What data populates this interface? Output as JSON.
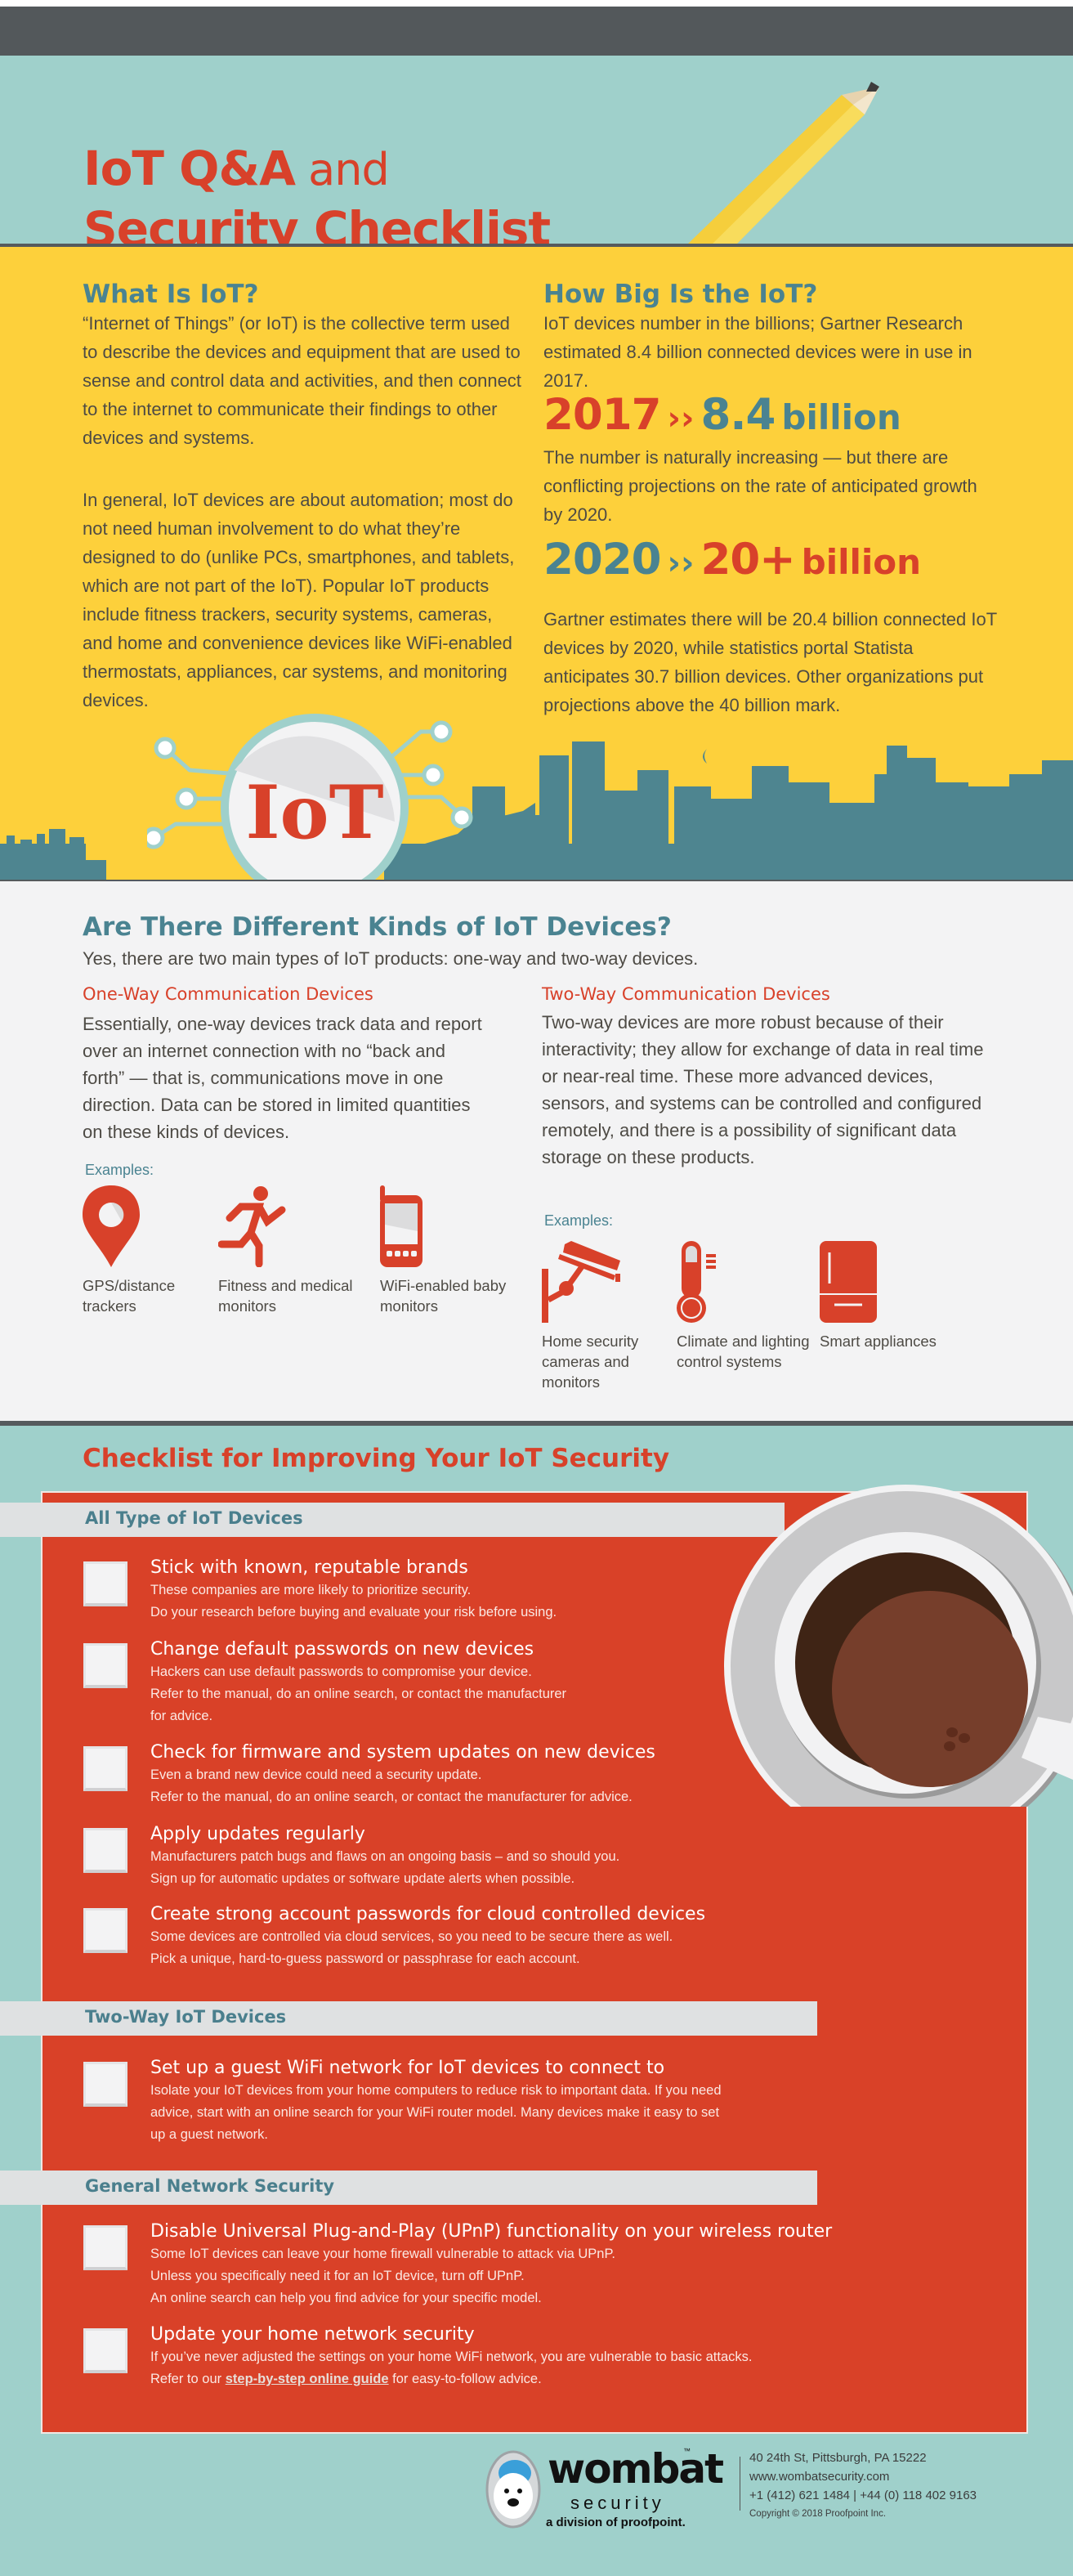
{
  "header": {
    "title_line1_bold": "IoT Q&A",
    "title_line1_light": " and",
    "title_line2": "Security Checklist"
  },
  "what_is_iot": {
    "title": "What Is IoT?",
    "paragraph1": "“Internet of Things” (or IoT) is the collective term used to describe the devices and equipment that are used to sense and control data and activities, and then connect to the internet to communicate their findings to other devices and systems.",
    "paragraph2": "In general, IoT devices are about automation; most do not need human involvement to do what they’re designed to do (unlike PCs, smartphones, and tablets, which are not part of the IoT). Popular IoT products include fitness trackers, security systems, cameras, and home and convenience devices like WiFi-enabled thermostats, appliances, car systems, and monitoring devices.",
    "badge_text": "IoT"
  },
  "how_big": {
    "title": "How Big Is the IoT?",
    "paragraph1": "IoT devices number in the billions; Gartner Research estimated 8.4 billion connected devices were in use in 2017.",
    "stat1": {
      "year": "2017",
      "arrow": "››",
      "value": "8.4",
      "unit": "billion"
    },
    "paragraph2": "The number is naturally increasing — but there are conflicting projections on the rate of anticipated growth by 2020.",
    "stat2": {
      "year": "2020",
      "arrow": "››",
      "value": "20+",
      "unit": "billion"
    },
    "paragraph3": "Gartner estimates there will be 20.4 billion connected IoT devices by 2020, while statistics portal Statista anticipates 30.7 billion devices. Other organizations put projections above the 40 billion mark."
  },
  "kinds": {
    "title": "Are There Different Kinds of IoT Devices?",
    "intro": "Yes, there are two main types of IoT products: one-way and two-way devices.",
    "one_way": {
      "title": "One-Way Communication Devices",
      "text": "Essentially, one-way devices track data and report over an internet connection with no “back and forth” — that is, communications move in one direction. Data can be stored in limited quantities on these kinds of devices.",
      "examples_label": "Examples:",
      "examples": [
        {
          "icon": "map-pin-icon",
          "label": "GPS/distance trackers"
        },
        {
          "icon": "runner-icon",
          "label": "Fitness and medical monitors"
        },
        {
          "icon": "phone-icon",
          "label": "WiFi-enabled baby monitors"
        }
      ]
    },
    "two_way": {
      "title": "Two-Way Communication Devices",
      "text": "Two-way devices are more robust because of their interactivity; they allow for exchange of data in real time or near-real time. These more advanced devices, sensors, and systems can be controlled and configured remotely, and there is a possibility of significant data storage on these products.",
      "examples_label": "Examples:",
      "examples": [
        {
          "icon": "security-camera-icon",
          "label": "Home security cameras and monitors"
        },
        {
          "icon": "thermometer-icon",
          "label": "Climate and lighting control systems"
        },
        {
          "icon": "refrigerator-icon",
          "label": "Smart appliances"
        }
      ]
    }
  },
  "checklist": {
    "title": "Checklist for Improving Your IoT Security",
    "categories": [
      {
        "label": "All Type of IoT Devices"
      },
      {
        "label": "Two-Way IoT Devices"
      },
      {
        "label": "General Network Security"
      }
    ],
    "items": [
      {
        "title": "Stick with known, reputable brands",
        "lines": [
          "These companies are more likely to prioritize security.",
          "Do your research before buying and evaluate your risk before using."
        ],
        "checked": false
      },
      {
        "title": "Change default passwords on new devices",
        "lines": [
          "Hackers can use default passwords to compromise your device.",
          "Refer to the manual, do an online search, or contact the manufacturer",
          "for advice."
        ],
        "checked": false
      },
      {
        "title": "Check for firmware and system updates on new devices",
        "lines": [
          "Even a brand new device could need a security update.",
          "Refer to the manual, do an online search, or contact the manufacturer for advice."
        ],
        "checked": false
      },
      {
        "title": "Apply updates regularly",
        "lines": [
          "Manufacturers patch bugs and flaws on an ongoing basis – and so should you.",
          "Sign up for automatic updates or software update alerts when possible."
        ],
        "checked": false
      },
      {
        "title": "Create strong account passwords for cloud controlled devices",
        "lines": [
          "Some devices are controlled via cloud services, so you need to be secure there as well.",
          "Pick a unique, hard-to-guess password or passphrase for each account."
        ],
        "checked": false
      },
      {
        "title": "Set up a guest WiFi network for IoT devices to connect to",
        "lines": [
          "Isolate your IoT devices from your home computers to reduce risk to important data. If you need",
          "advice, start with an online search for your WiFi router model. Many devices make it easy to set",
          "up a guest network."
        ],
        "checked": false
      },
      {
        "title": "Disable Universal Plug-and-Play (UPnP) functionality on your wireless router",
        "lines": [
          "Some IoT devices can leave your home firewall vulnerable to attack via UPnP.",
          "Unless you specifically need it for an IoT device, turn off UPnP.",
          "An online search can help you find advice for your specific model."
        ],
        "checked": false
      },
      {
        "title": "Update your home network security",
        "lines": [
          "If you’ve never adjusted the settings on your home WiFi network, you are vulnerable to basic attacks."
        ],
        "link_prefix": "Refer to our ",
        "link_text": "step-by-step online guide",
        "link_suffix": " for easy-to-follow advice.",
        "checked": false
      }
    ]
  },
  "footer": {
    "brand": "wombat",
    "brand_sub": "security",
    "trademark": "™",
    "division": "a division of proofpoint.",
    "address": "40 24th St, Pittsburgh, PA 15222",
    "website": "www.wombatsecurity.com",
    "phones": "+1 (412) 621 1484 |  +44 (0) 118 402 9163",
    "copyright": "Copyright © 2018 Proofpoint Inc."
  },
  "colors": {
    "teal_bg": "#9fd0cb",
    "dark_bar": "#53585b",
    "yellow": "#fdd03b",
    "red": "#d8412a",
    "blue_heading": "#4a8391",
    "light_grey": "#f3f3f4"
  }
}
